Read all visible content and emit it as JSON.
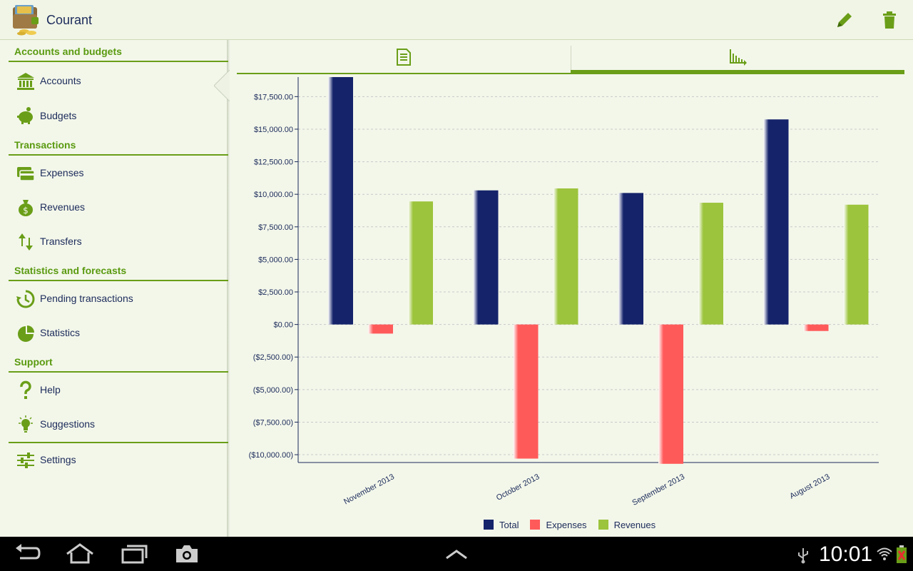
{
  "app": {
    "title": "Courant"
  },
  "colors": {
    "accent": "#6a9e18",
    "total": "#15236b",
    "expenses": "#ff5a5a",
    "revenues": "#9cc43c",
    "text": "#1b2a5a"
  },
  "sidebar": {
    "sections": [
      {
        "header": "Accounts and budgets",
        "items": [
          {
            "label": "Accounts",
            "icon": "bank-icon",
            "active": true
          },
          {
            "label": "Budgets",
            "icon": "piggy-bank-icon"
          }
        ]
      },
      {
        "header": "Transactions",
        "items": [
          {
            "label": "Expenses",
            "icon": "credit-card-icon"
          },
          {
            "label": "Revenues",
            "icon": "money-bag-icon"
          },
          {
            "label": "Transfers",
            "icon": "transfer-arrows-icon"
          }
        ]
      },
      {
        "header": "Statistics and forecasts",
        "items": [
          {
            "label": "Pending transactions",
            "icon": "pending-clock-icon"
          },
          {
            "label": "Statistics",
            "icon": "pie-chart-icon"
          }
        ]
      },
      {
        "header": "Support",
        "items": [
          {
            "label": "Help",
            "icon": "question-mark-icon"
          },
          {
            "label": "Suggestions",
            "icon": "light-bulb-icon"
          }
        ]
      }
    ],
    "settings": {
      "label": "Settings",
      "icon": "sliders-icon"
    }
  },
  "tabs": [
    {
      "name": "details",
      "icon": "document-icon",
      "selected": false
    },
    {
      "name": "chart",
      "icon": "bar-chart-icon",
      "selected": true
    }
  ],
  "chart_data": {
    "type": "bar",
    "categories": [
      "November 2013",
      "October 2013",
      "September 2013",
      "August 2013"
    ],
    "series": [
      {
        "name": "Total",
        "values": [
          19000,
          10300,
          10100,
          15750
        ]
      },
      {
        "name": "Expenses",
        "values": [
          -700,
          -10300,
          -10700,
          -500
        ]
      },
      {
        "name": "Revenues",
        "values": [
          9450,
          10450,
          9350,
          9200
        ]
      }
    ],
    "ylim": [
      -10600,
      19000
    ],
    "yticks": [
      17500,
      15000,
      12500,
      10000,
      7500,
      5000,
      2500,
      0,
      -2500,
      -5000,
      -7500,
      -10000
    ],
    "ytick_labels": [
      "$17,500.00",
      "$15,000.00",
      "$12,500.00",
      "$10,000.00",
      "$7,500.00",
      "$5,000.00",
      "$2,500.00",
      "$0.00",
      "($2,500.00)",
      "($5,000.00)",
      "($7,500.00)",
      "($10,000.00)"
    ],
    "grid": true,
    "legend": "bottom-center"
  },
  "system_bar": {
    "time": "10:01"
  }
}
